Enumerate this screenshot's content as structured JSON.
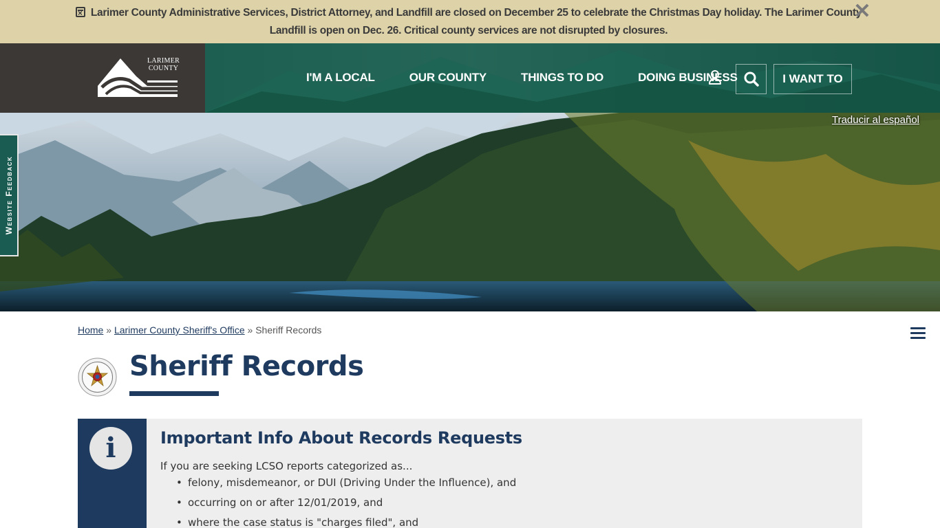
{
  "alert": {
    "text": "Larimer County Administrative Services, District Attorney, and Landfill are closed on December 25 to celebrate the Christmas Day holiday. The Larimer County Landfill is open on Dec. 26. Critical county services are not disrupted by closures.",
    "close_label": "✕"
  },
  "header": {
    "logo_text_line1": "LARIMER",
    "logo_text_line2": "COUNTY",
    "nav": [
      {
        "label": "I'M A LOCAL"
      },
      {
        "label": "OUR COUNTY"
      },
      {
        "label": "THINGS TO DO"
      },
      {
        "label": "DOING BUSINESS"
      }
    ],
    "i_want_to": "I WANT TO"
  },
  "hero": {
    "translate": "Traducir al español"
  },
  "feedback_tab": "Website Feedback",
  "breadcrumb": {
    "home": "Home",
    "separator": "»",
    "parent": "Larimer County Sheriff's Office",
    "current": "Sheriff Records"
  },
  "page_title": "Sheriff Records",
  "info": {
    "icon": "i",
    "title": "Important Info About Records Requests",
    "intro": "If you are seeking LCSO reports categorized as...",
    "items": [
      "felony, misdemeanor, or DUI (Driving Under the Influence), and",
      "occurring on or after 12/01/2019, and",
      "where the case status is \"charges filed\", and"
    ]
  },
  "colors": {
    "alert_bg": "#ddd2a8",
    "header_green": "#175c4d",
    "logo_box": "#3b3836",
    "navy": "#1e3a5f"
  },
  "icons": {
    "alert": "calendar-x-icon",
    "user": "user-icon",
    "search": "search-icon",
    "menu": "hamburger-menu-icon",
    "info": "info-icon"
  }
}
